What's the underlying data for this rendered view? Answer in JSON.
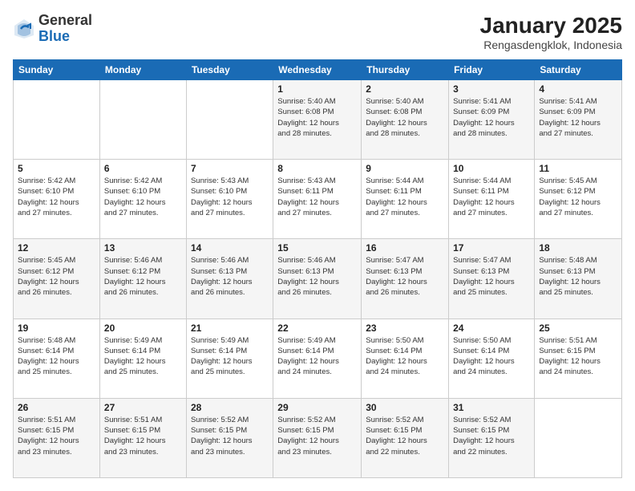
{
  "header": {
    "logo_general": "General",
    "logo_blue": "Blue",
    "title": "January 2025",
    "subtitle": "Rengasdengklok, Indonesia"
  },
  "weekdays": [
    "Sunday",
    "Monday",
    "Tuesday",
    "Wednesday",
    "Thursday",
    "Friday",
    "Saturday"
  ],
  "weeks": [
    [
      {
        "day": "",
        "info": ""
      },
      {
        "day": "",
        "info": ""
      },
      {
        "day": "",
        "info": ""
      },
      {
        "day": "1",
        "info": "Sunrise: 5:40 AM\nSunset: 6:08 PM\nDaylight: 12 hours\nand 28 minutes."
      },
      {
        "day": "2",
        "info": "Sunrise: 5:40 AM\nSunset: 6:08 PM\nDaylight: 12 hours\nand 28 minutes."
      },
      {
        "day": "3",
        "info": "Sunrise: 5:41 AM\nSunset: 6:09 PM\nDaylight: 12 hours\nand 28 minutes."
      },
      {
        "day": "4",
        "info": "Sunrise: 5:41 AM\nSunset: 6:09 PM\nDaylight: 12 hours\nand 27 minutes."
      }
    ],
    [
      {
        "day": "5",
        "info": "Sunrise: 5:42 AM\nSunset: 6:10 PM\nDaylight: 12 hours\nand 27 minutes."
      },
      {
        "day": "6",
        "info": "Sunrise: 5:42 AM\nSunset: 6:10 PM\nDaylight: 12 hours\nand 27 minutes."
      },
      {
        "day": "7",
        "info": "Sunrise: 5:43 AM\nSunset: 6:10 PM\nDaylight: 12 hours\nand 27 minutes."
      },
      {
        "day": "8",
        "info": "Sunrise: 5:43 AM\nSunset: 6:11 PM\nDaylight: 12 hours\nand 27 minutes."
      },
      {
        "day": "9",
        "info": "Sunrise: 5:44 AM\nSunset: 6:11 PM\nDaylight: 12 hours\nand 27 minutes."
      },
      {
        "day": "10",
        "info": "Sunrise: 5:44 AM\nSunset: 6:11 PM\nDaylight: 12 hours\nand 27 minutes."
      },
      {
        "day": "11",
        "info": "Sunrise: 5:45 AM\nSunset: 6:12 PM\nDaylight: 12 hours\nand 27 minutes."
      }
    ],
    [
      {
        "day": "12",
        "info": "Sunrise: 5:45 AM\nSunset: 6:12 PM\nDaylight: 12 hours\nand 26 minutes."
      },
      {
        "day": "13",
        "info": "Sunrise: 5:46 AM\nSunset: 6:12 PM\nDaylight: 12 hours\nand 26 minutes."
      },
      {
        "day": "14",
        "info": "Sunrise: 5:46 AM\nSunset: 6:13 PM\nDaylight: 12 hours\nand 26 minutes."
      },
      {
        "day": "15",
        "info": "Sunrise: 5:46 AM\nSunset: 6:13 PM\nDaylight: 12 hours\nand 26 minutes."
      },
      {
        "day": "16",
        "info": "Sunrise: 5:47 AM\nSunset: 6:13 PM\nDaylight: 12 hours\nand 26 minutes."
      },
      {
        "day": "17",
        "info": "Sunrise: 5:47 AM\nSunset: 6:13 PM\nDaylight: 12 hours\nand 25 minutes."
      },
      {
        "day": "18",
        "info": "Sunrise: 5:48 AM\nSunset: 6:13 PM\nDaylight: 12 hours\nand 25 minutes."
      }
    ],
    [
      {
        "day": "19",
        "info": "Sunrise: 5:48 AM\nSunset: 6:14 PM\nDaylight: 12 hours\nand 25 minutes."
      },
      {
        "day": "20",
        "info": "Sunrise: 5:49 AM\nSunset: 6:14 PM\nDaylight: 12 hours\nand 25 minutes."
      },
      {
        "day": "21",
        "info": "Sunrise: 5:49 AM\nSunset: 6:14 PM\nDaylight: 12 hours\nand 25 minutes."
      },
      {
        "day": "22",
        "info": "Sunrise: 5:49 AM\nSunset: 6:14 PM\nDaylight: 12 hours\nand 24 minutes."
      },
      {
        "day": "23",
        "info": "Sunrise: 5:50 AM\nSunset: 6:14 PM\nDaylight: 12 hours\nand 24 minutes."
      },
      {
        "day": "24",
        "info": "Sunrise: 5:50 AM\nSunset: 6:14 PM\nDaylight: 12 hours\nand 24 minutes."
      },
      {
        "day": "25",
        "info": "Sunrise: 5:51 AM\nSunset: 6:15 PM\nDaylight: 12 hours\nand 24 minutes."
      }
    ],
    [
      {
        "day": "26",
        "info": "Sunrise: 5:51 AM\nSunset: 6:15 PM\nDaylight: 12 hours\nand 23 minutes."
      },
      {
        "day": "27",
        "info": "Sunrise: 5:51 AM\nSunset: 6:15 PM\nDaylight: 12 hours\nand 23 minutes."
      },
      {
        "day": "28",
        "info": "Sunrise: 5:52 AM\nSunset: 6:15 PM\nDaylight: 12 hours\nand 23 minutes."
      },
      {
        "day": "29",
        "info": "Sunrise: 5:52 AM\nSunset: 6:15 PM\nDaylight: 12 hours\nand 23 minutes."
      },
      {
        "day": "30",
        "info": "Sunrise: 5:52 AM\nSunset: 6:15 PM\nDaylight: 12 hours\nand 22 minutes."
      },
      {
        "day": "31",
        "info": "Sunrise: 5:52 AM\nSunset: 6:15 PM\nDaylight: 12 hours\nand 22 minutes."
      },
      {
        "day": "",
        "info": ""
      }
    ]
  ]
}
